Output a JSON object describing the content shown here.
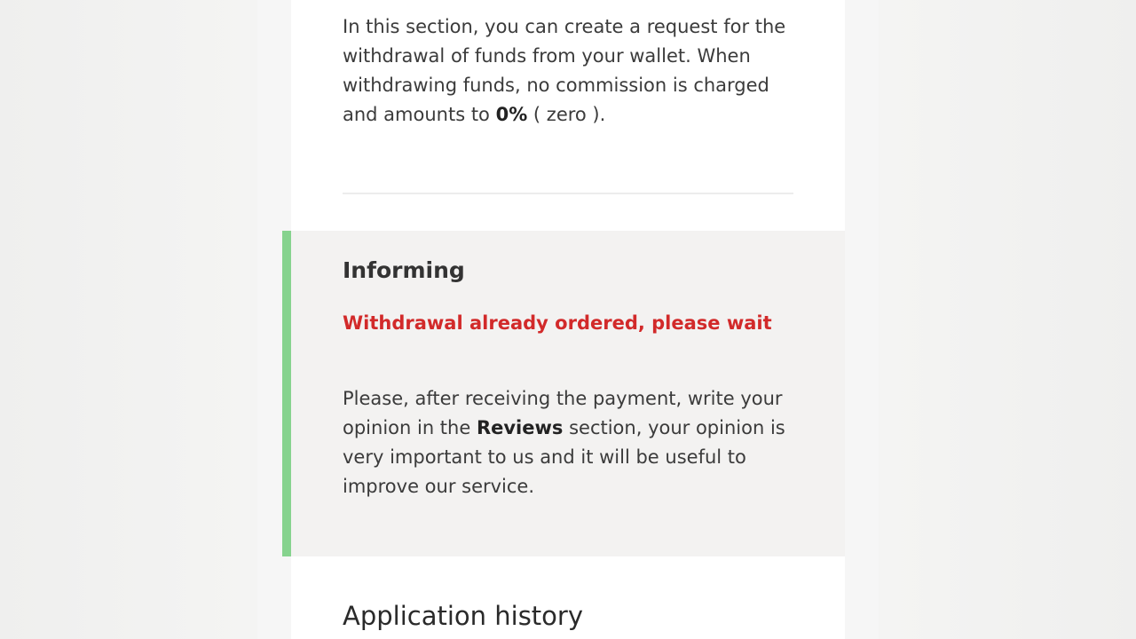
{
  "intro": {
    "text_before": "In this section, you can create a request for the withdrawal of funds from your wallet. When withdrawing funds, no commission is charged and amounts to ",
    "commission_value": "0%",
    "text_after": " ( zero )."
  },
  "notice": {
    "title": "Informing",
    "alert": "Withdrawal already ordered, please wait",
    "body_before": "Please, after receiving the payment, write your opinion in the ",
    "body_link": "Reviews",
    "body_after": " section, your opinion is very important to us and it will be useful to improve our service.",
    "accent_color": "#86d38e",
    "alert_color": "#d22a2a"
  },
  "history": {
    "title": "Application history"
  }
}
